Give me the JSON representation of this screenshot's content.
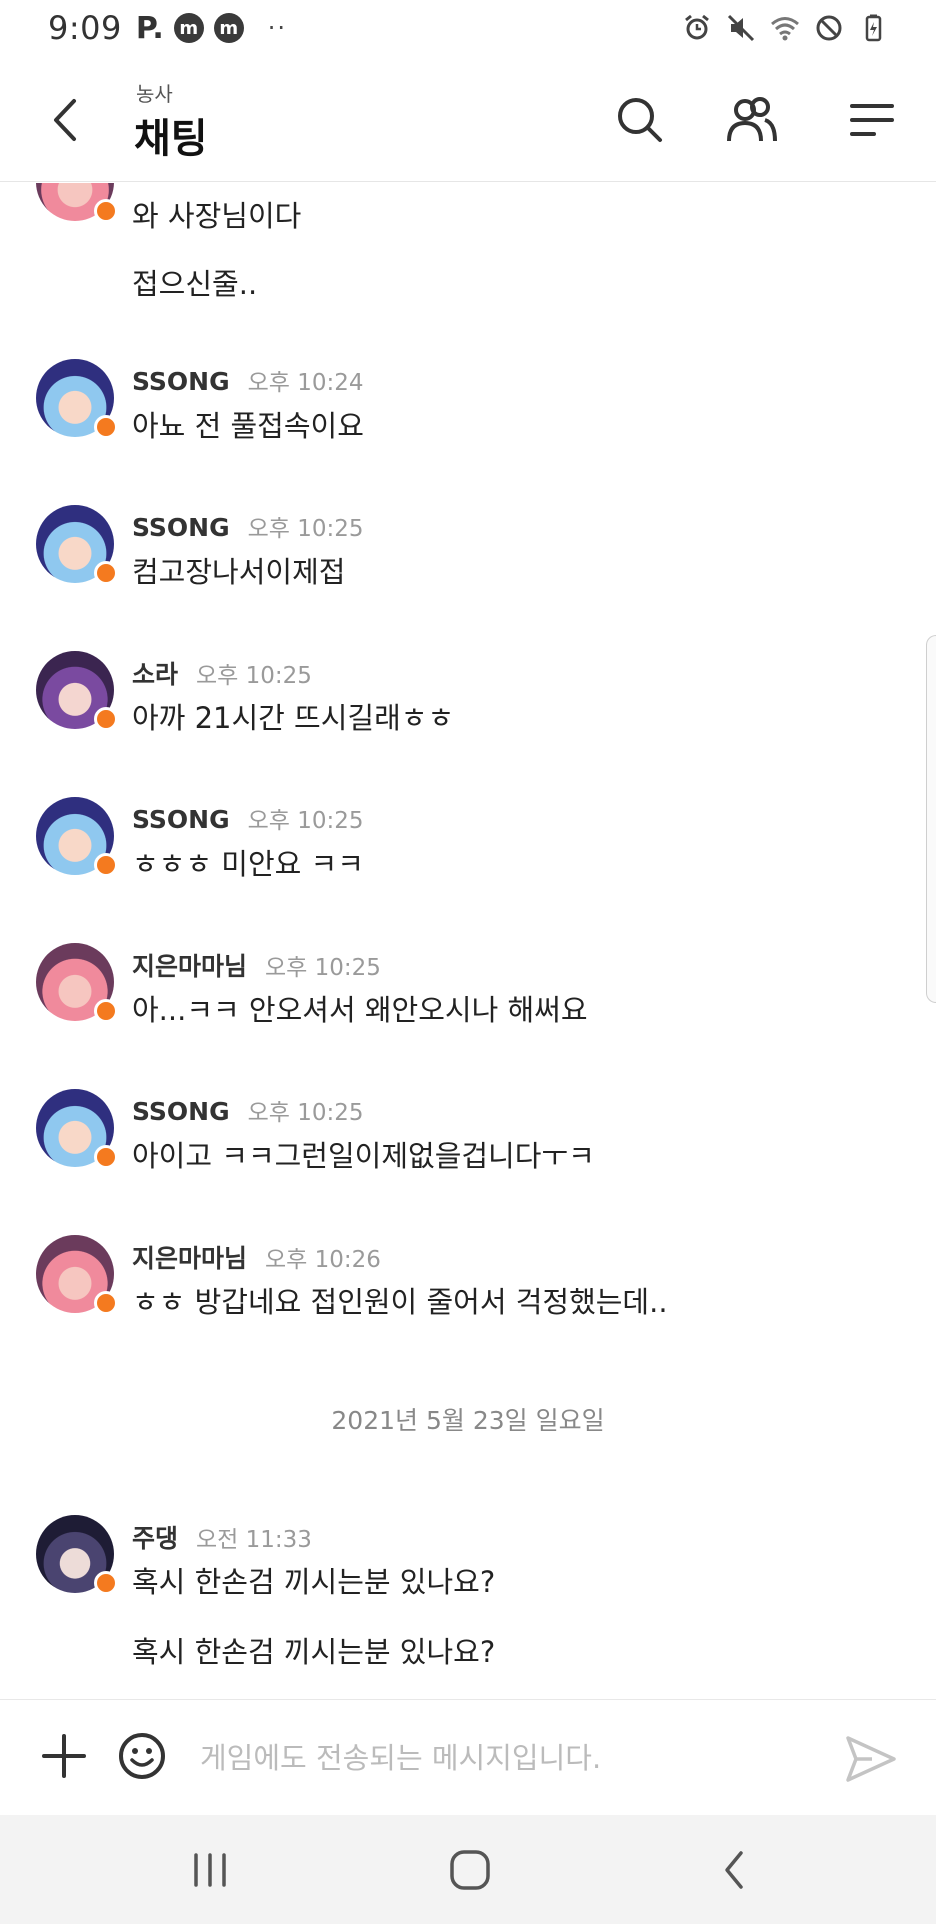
{
  "status_bar": {
    "time": "9:09",
    "p_label": "P.",
    "m_label": "m",
    "dots": "··"
  },
  "header": {
    "subtitle": "농사",
    "title": "채팅"
  },
  "messages": [
    {
      "sender": "",
      "time": "",
      "lines": [
        "와 사장님이다",
        "접으신줄.."
      ]
    },
    {
      "sender": "SSONG",
      "time": "오후 10:24",
      "lines": [
        "아뇨 전 풀접속이요"
      ]
    },
    {
      "sender": "SSONG",
      "time": "오후 10:25",
      "lines": [
        "컴고장나서이제접"
      ]
    },
    {
      "sender": "소라",
      "time": "오후 10:25",
      "lines": [
        "아까 21시간 뜨시길래ㅎㅎ"
      ]
    },
    {
      "sender": "SSONG",
      "time": "오후 10:25",
      "lines": [
        "ㅎㅎㅎ 미안요 ㅋㅋ"
      ]
    },
    {
      "sender": "지은마마님",
      "time": "오후 10:25",
      "lines": [
        "아...ㅋㅋ 안오셔서 왜안오시나 해써요"
      ]
    },
    {
      "sender": "SSONG",
      "time": "오후 10:25",
      "lines": [
        "아이고 ㅋㅋ그런일이제없을겁니다ㅜㅋ"
      ]
    },
    {
      "sender": "지은마마님",
      "time": "오후 10:26",
      "lines": [
        "ㅎㅎ 방갑네요 접인원이 줄어서 걱정했는데.."
      ]
    },
    {
      "sender": "주댕",
      "time": "오전 11:33",
      "lines": [
        "혹시 한손검 끼시는분 있나요?",
        "혹시 한손검 끼시는분 있나요?"
      ]
    }
  ],
  "date_separator": "2021년 5월 23일 일요일",
  "input": {
    "placeholder": "게임에도 전송되는 메시지입니다."
  },
  "colors": {
    "online_dot": "#f47a1f",
    "ssong_avatar": "#3b3f8f",
    "sora_avatar": "#5a3b7a",
    "jieun_avatar": "#7a4b6a",
    "judaeng_avatar": "#2c2a45"
  }
}
